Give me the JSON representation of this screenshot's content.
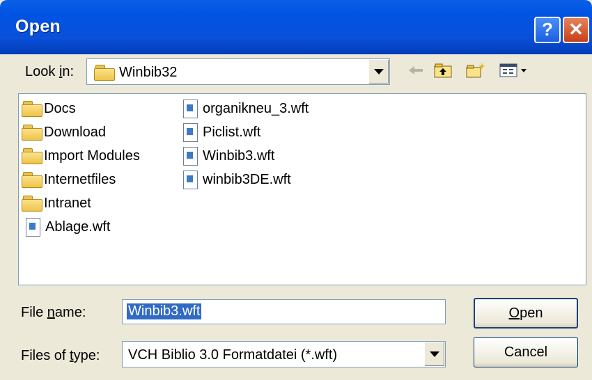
{
  "window": {
    "title": "Open"
  },
  "title_buttons": {
    "help": "?",
    "close": "✕"
  },
  "look_in": {
    "label_pre": "Look ",
    "label_key": "i",
    "label_post": "n:",
    "value": "Winbib32"
  },
  "files": {
    "col1": [
      {
        "name": "Docs",
        "type": "folder"
      },
      {
        "name": "Download",
        "type": "folder"
      },
      {
        "name": "Import Modules",
        "type": "folder"
      },
      {
        "name": "Internetfiles",
        "type": "folder"
      },
      {
        "name": "Intranet",
        "type": "folder"
      },
      {
        "name": "Ablage.wft",
        "type": "file"
      }
    ],
    "col2": [
      {
        "name": "organikneu_3.wft",
        "type": "file"
      },
      {
        "name": "Piclist.wft",
        "type": "file"
      },
      {
        "name": "Winbib3.wft",
        "type": "file"
      },
      {
        "name": "winbib3DE.wft",
        "type": "file"
      }
    ]
  },
  "file_name": {
    "label_pre": "File ",
    "label_key": "n",
    "label_post": "ame:",
    "value": "Winbib3.wft"
  },
  "file_type": {
    "label_pre": "Files of ",
    "label_key": "t",
    "label_post": "ype:",
    "value": "VCH Biblio 3.0 Formatdatei (*.wft)"
  },
  "buttons": {
    "open_key": "O",
    "open_rest": "pen",
    "cancel": "Cancel"
  },
  "colors": {
    "title_bar": "#0054e3",
    "selection": "#316ac5",
    "dialog_bg": "#ece9d8"
  }
}
